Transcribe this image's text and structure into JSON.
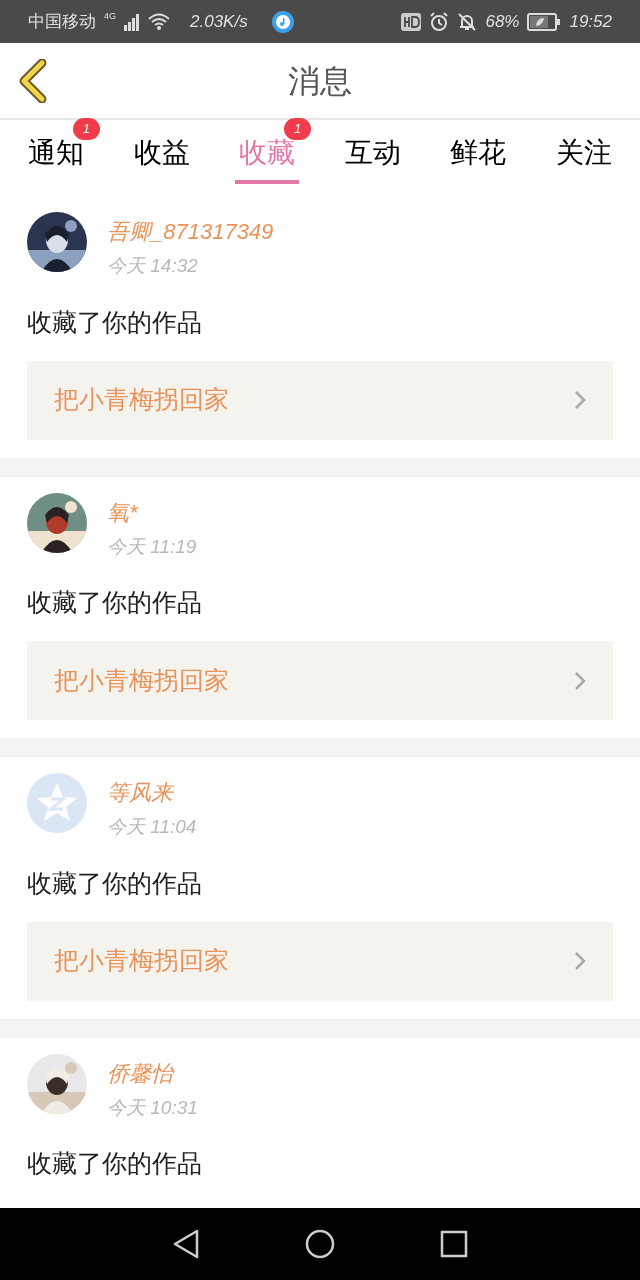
{
  "status_bar": {
    "carrier": "中国移动",
    "network": "4G",
    "speed": "2.03K/s",
    "battery": "68%",
    "time": "19:52"
  },
  "header": {
    "title": "消息"
  },
  "tabs": [
    {
      "label": "通知",
      "selected": false,
      "badge": "1"
    },
    {
      "label": "收益",
      "selected": false
    },
    {
      "label": "收藏",
      "selected": true,
      "badge": "1"
    },
    {
      "label": "互动",
      "selected": false
    },
    {
      "label": "鲜花",
      "selected": false
    },
    {
      "label": "关注",
      "selected": false
    }
  ],
  "messages": [
    {
      "name": "吾卿_871317349",
      "time": "今天 14:32",
      "action": "收藏了你的作品",
      "work": "把小青梅拐回家"
    },
    {
      "name": "氧*",
      "time": "今天 11:19",
      "action": "收藏了你的作品",
      "work": "把小青梅拐回家"
    },
    {
      "avatar": {
        "kind": "default"
      },
      "name": "等风来",
      "time": "今天 11:04",
      "action": "收藏了你的作品",
      "work": "把小青梅拐回家"
    },
    {
      "name": "侨馨怡",
      "time": "今天 10:31",
      "action": "收藏了你的作品"
    }
  ]
}
